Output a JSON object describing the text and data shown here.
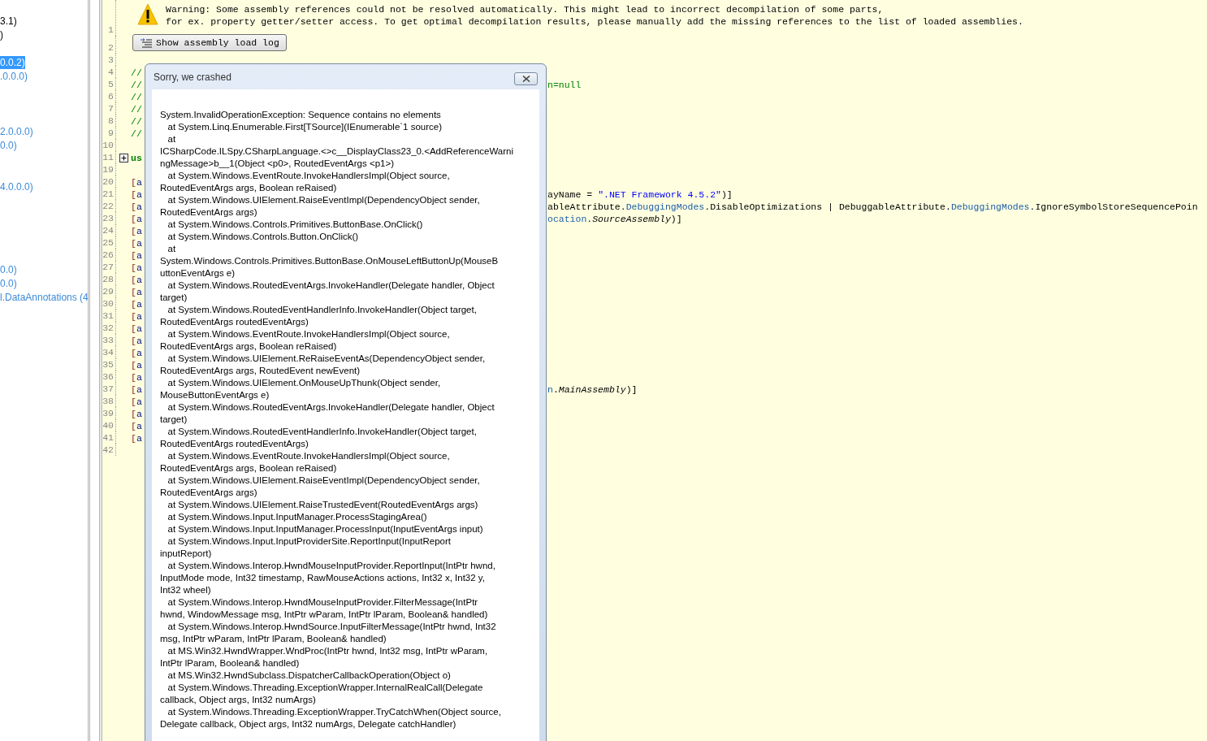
{
  "tree": {
    "items": [
      {
        "kind": "blank"
      },
      {
        "kind": "normal",
        "text": "3.1)",
        "selected": false
      },
      {
        "kind": "normal",
        "text": ")",
        "selected": false
      },
      {
        "kind": "blank"
      },
      {
        "kind": "normal",
        "text": "0.0.2)",
        "selected": true
      },
      {
        "kind": "dim",
        "text": ".0.0.0)",
        "selected": false
      },
      {
        "kind": "blank"
      },
      {
        "kind": "blank"
      },
      {
        "kind": "blank"
      },
      {
        "kind": "dim",
        "text": "2.0.0.0)",
        "selected": false
      },
      {
        "kind": "dim",
        "text": "0.0)",
        "selected": false
      },
      {
        "kind": "blank"
      },
      {
        "kind": "blank"
      },
      {
        "kind": "dim",
        "text": "4.0.0.0)",
        "selected": false
      },
      {
        "kind": "blank"
      },
      {
        "kind": "blank"
      },
      {
        "kind": "blank"
      },
      {
        "kind": "blank"
      },
      {
        "kind": "blank"
      },
      {
        "kind": "dim",
        "text": "0.0)",
        "selected": false
      },
      {
        "kind": "dim",
        "text": "0.0)",
        "selected": false
      },
      {
        "kind": "dim",
        "text": "l.DataAnnotations (4",
        "selected": false
      }
    ]
  },
  "editor": {
    "lines": [
      {
        "kind": "warning",
        "number": "1",
        "text": "Warning: Some assembly references could not be resolved automatically. This might lead to incorrect decompilation of some parts,\nfor ex. property getter/setter access. To get optimal decompilation results, please manually add the missing references to the list of loaded assemblies."
      },
      {
        "kind": "button",
        "number": "2",
        "label": "Show assembly load log"
      },
      {
        "kind": "code",
        "number": "3"
      },
      {
        "kind": "code",
        "number": "4",
        "left": [
          {
            "kind": "comment",
            "text": "//"
          }
        ]
      },
      {
        "kind": "code",
        "number": "5",
        "left": [
          {
            "kind": "comment",
            "text": "//"
          }
        ],
        "right": [
          {
            "kind": "comment",
            "text": "n=null"
          }
        ]
      },
      {
        "kind": "code",
        "number": "6",
        "left": [
          {
            "kind": "comment",
            "text": "//"
          }
        ]
      },
      {
        "kind": "code",
        "number": "7",
        "left": [
          {
            "kind": "comment",
            "text": "//"
          }
        ]
      },
      {
        "kind": "code",
        "number": "8",
        "left": [
          {
            "kind": "comment",
            "text": "//"
          }
        ]
      },
      {
        "kind": "code",
        "number": "9",
        "left": [
          {
            "kind": "comment",
            "text": "//"
          }
        ]
      },
      {
        "kind": "code",
        "number": "10"
      },
      {
        "kind": "code",
        "number": "11",
        "expanded": false,
        "left": [
          {
            "kind": "keyword",
            "text": "us"
          }
        ]
      },
      {
        "kind": "code",
        "number": "19"
      },
      {
        "kind": "code",
        "number": "20",
        "left": [
          {
            "kind": "bracket",
            "text": "["
          },
          {
            "kind": "attr",
            "text": "a"
          }
        ]
      },
      {
        "kind": "code",
        "number": "21",
        "left": [
          {
            "kind": "bracket",
            "text": "["
          },
          {
            "kind": "attr",
            "text": "a"
          }
        ],
        "right": [
          {
            "kind": "plain",
            "text": "ayName = "
          },
          {
            "kind": "string",
            "text": "\".NET Framework 4.5.2\""
          },
          {
            "kind": "plain",
            "text": ")]"
          }
        ]
      },
      {
        "kind": "code",
        "number": "22",
        "left": [
          {
            "kind": "bracket",
            "text": "["
          },
          {
            "kind": "attr",
            "text": "a"
          }
        ],
        "right": [
          {
            "kind": "plain",
            "text": "ableAttribute."
          },
          {
            "kind": "type",
            "text": "DebuggingModes"
          },
          {
            "kind": "plain",
            "text": ".DisableOptimizations | DebuggableAttribute."
          },
          {
            "kind": "type",
            "text": "DebuggingModes"
          },
          {
            "kind": "plain",
            "text": ".IgnoreSymbolStoreSequencePoin"
          }
        ]
      },
      {
        "kind": "code",
        "number": "23",
        "left": [
          {
            "kind": "bracket",
            "text": "["
          },
          {
            "kind": "attr",
            "text": "a"
          }
        ],
        "right": [
          {
            "kind": "type",
            "text": "ocation"
          },
          {
            "kind": "plain",
            "text": "."
          },
          {
            "kind": "italic",
            "text": "SourceAssembly"
          },
          {
            "kind": "plain",
            "text": ")]"
          }
        ]
      },
      {
        "kind": "code",
        "number": "24",
        "left": [
          {
            "kind": "bracket",
            "text": "["
          },
          {
            "kind": "attr",
            "text": "a"
          }
        ]
      },
      {
        "kind": "code",
        "number": "25",
        "left": [
          {
            "kind": "bracket",
            "text": "["
          },
          {
            "kind": "attr",
            "text": "a"
          }
        ]
      },
      {
        "kind": "code",
        "number": "26",
        "left": [
          {
            "kind": "bracket",
            "text": "["
          },
          {
            "kind": "attr",
            "text": "a"
          }
        ]
      },
      {
        "kind": "code",
        "number": "27",
        "left": [
          {
            "kind": "bracket",
            "text": "["
          },
          {
            "kind": "attr",
            "text": "a"
          }
        ]
      },
      {
        "kind": "code",
        "number": "28",
        "left": [
          {
            "kind": "bracket",
            "text": "["
          },
          {
            "kind": "attr",
            "text": "a"
          }
        ]
      },
      {
        "kind": "code",
        "number": "29",
        "left": [
          {
            "kind": "bracket",
            "text": "["
          },
          {
            "kind": "attr",
            "text": "a"
          }
        ]
      },
      {
        "kind": "code",
        "number": "30",
        "left": [
          {
            "kind": "bracket",
            "text": "["
          },
          {
            "kind": "attr",
            "text": "a"
          }
        ]
      },
      {
        "kind": "code",
        "number": "31",
        "left": [
          {
            "kind": "bracket",
            "text": "["
          },
          {
            "kind": "attr",
            "text": "a"
          }
        ]
      },
      {
        "kind": "code",
        "number": "32",
        "left": [
          {
            "kind": "bracket",
            "text": "["
          },
          {
            "kind": "attr",
            "text": "a"
          }
        ]
      },
      {
        "kind": "code",
        "number": "33",
        "left": [
          {
            "kind": "bracket",
            "text": "["
          },
          {
            "kind": "attr",
            "text": "a"
          }
        ]
      },
      {
        "kind": "code",
        "number": "34",
        "left": [
          {
            "kind": "bracket",
            "text": "["
          },
          {
            "kind": "attr",
            "text": "a"
          }
        ]
      },
      {
        "kind": "code",
        "number": "35",
        "left": [
          {
            "kind": "bracket",
            "text": "["
          },
          {
            "kind": "attr",
            "text": "a"
          }
        ]
      },
      {
        "kind": "code",
        "number": "36",
        "left": [
          {
            "kind": "bracket",
            "text": "["
          },
          {
            "kind": "attr",
            "text": "a"
          }
        ]
      },
      {
        "kind": "code",
        "number": "37",
        "left": [
          {
            "kind": "bracket",
            "text": "["
          },
          {
            "kind": "attr",
            "text": "a"
          }
        ],
        "right": [
          {
            "kind": "type",
            "text": "n"
          },
          {
            "kind": "plain",
            "text": "."
          },
          {
            "kind": "italic",
            "text": "MainAssembly"
          },
          {
            "kind": "plain",
            "text": ")]"
          }
        ]
      },
      {
        "kind": "code",
        "number": "38",
        "left": [
          {
            "kind": "bracket",
            "text": "["
          },
          {
            "kind": "attr",
            "text": "a"
          }
        ]
      },
      {
        "kind": "code",
        "number": "39",
        "left": [
          {
            "kind": "bracket",
            "text": "["
          },
          {
            "kind": "attr",
            "text": "a"
          }
        ]
      },
      {
        "kind": "code",
        "number": "40",
        "left": [
          {
            "kind": "bracket",
            "text": "["
          },
          {
            "kind": "attr",
            "text": "a"
          }
        ]
      },
      {
        "kind": "code",
        "number": "41",
        "left": [
          {
            "kind": "bracket",
            "text": "["
          },
          {
            "kind": "attr",
            "text": "a"
          }
        ]
      },
      {
        "kind": "code",
        "number": "42"
      }
    ]
  },
  "dialog": {
    "title": "Sorry, we crashed",
    "lines": [
      "System.InvalidOperationException: Sequence contains no elements",
      "   at System.Linq.Enumerable.First[TSource](IEnumerable`1 source)",
      "   at",
      "ICSharpCode.ILSpy.CSharpLanguage.<>c__DisplayClass23_0.<AddReferenceWarni",
      "ngMessage>b__1(Object <p0>, RoutedEventArgs <p1>)",
      "   at System.Windows.EventRoute.InvokeHandlersImpl(Object source,",
      "RoutedEventArgs args, Boolean reRaised)",
      "   at System.Windows.UIElement.RaiseEventImpl(DependencyObject sender,",
      "RoutedEventArgs args)",
      "   at System.Windows.Controls.Primitives.ButtonBase.OnClick()",
      "   at System.Windows.Controls.Button.OnClick()",
      "   at",
      "System.Windows.Controls.Primitives.ButtonBase.OnMouseLeftButtonUp(MouseB",
      "uttonEventArgs e)",
      "   at System.Windows.RoutedEventArgs.InvokeHandler(Delegate handler, Object",
      "target)",
      "   at System.Windows.RoutedEventHandlerInfo.InvokeHandler(Object target,",
      "RoutedEventArgs routedEventArgs)",
      "   at System.Windows.EventRoute.InvokeHandlersImpl(Object source,",
      "RoutedEventArgs args, Boolean reRaised)",
      "   at System.Windows.UIElement.ReRaiseEventAs(DependencyObject sender,",
      "RoutedEventArgs args, RoutedEvent newEvent)",
      "   at System.Windows.UIElement.OnMouseUpThunk(Object sender,",
      "MouseButtonEventArgs e)",
      "   at System.Windows.RoutedEventArgs.InvokeHandler(Delegate handler, Object",
      "target)",
      "   at System.Windows.RoutedEventHandlerInfo.InvokeHandler(Object target,",
      "RoutedEventArgs routedEventArgs)",
      "   at System.Windows.EventRoute.InvokeHandlersImpl(Object source,",
      "RoutedEventArgs args, Boolean reRaised)",
      "   at System.Windows.UIElement.RaiseEventImpl(DependencyObject sender,",
      "RoutedEventArgs args)",
      "   at System.Windows.UIElement.RaiseTrustedEvent(RoutedEventArgs args)",
      "   at System.Windows.Input.InputManager.ProcessStagingArea()",
      "   at System.Windows.Input.InputManager.ProcessInput(InputEventArgs input)",
      "   at System.Windows.Input.InputProviderSite.ReportInput(InputReport",
      "inputReport)",
      "   at System.Windows.Interop.HwndMouseInputProvider.ReportInput(IntPtr hwnd,",
      "InputMode mode, Int32 timestamp, RawMouseActions actions, Int32 x, Int32 y,",
      "Int32 wheel)",
      "   at System.Windows.Interop.HwndMouseInputProvider.FilterMessage(IntPtr",
      "hwnd, WindowMessage msg, IntPtr wParam, IntPtr lParam, Boolean& handled)",
      "   at System.Windows.Interop.HwndSource.InputFilterMessage(IntPtr hwnd, Int32",
      "msg, IntPtr wParam, IntPtr lParam, Boolean& handled)",
      "   at MS.Win32.HwndWrapper.WndProc(IntPtr hwnd, Int32 msg, IntPtr wParam,",
      "IntPtr lParam, Boolean& handled)",
      "   at MS.Win32.HwndSubclass.DispatcherCallbackOperation(Object o)",
      "   at System.Windows.Threading.ExceptionWrapper.InternalRealCall(Delegate",
      "callback, Object args, Int32 numArgs)",
      "   at System.Windows.Threading.ExceptionWrapper.TryCatchWhen(Object source,",
      "Delegate callback, Object args, Int32 numArgs, Delegate catchHandler)"
    ]
  }
}
